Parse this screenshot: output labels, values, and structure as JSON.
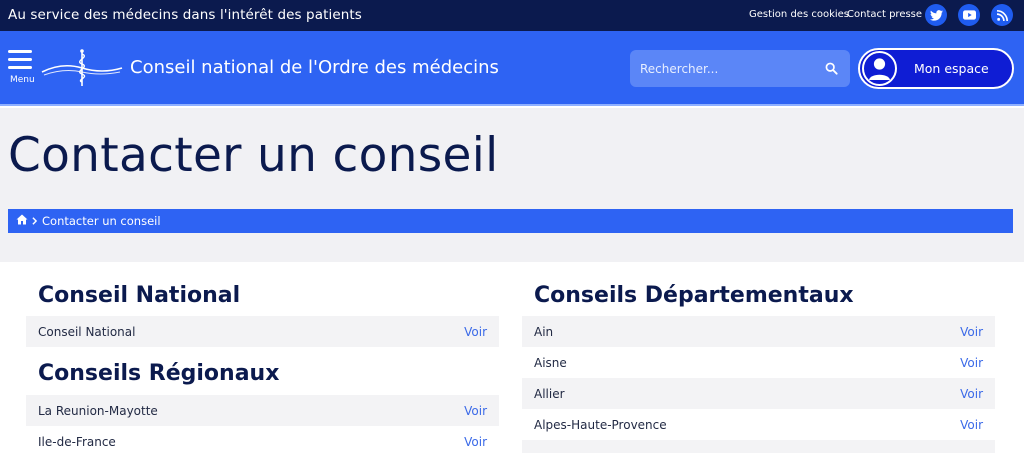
{
  "topbar": {
    "tagline": "Au service des médecins dans l'intérêt des patients",
    "links": [
      "Gestion des cookies",
      "Contact presse"
    ],
    "social_icons": [
      "twitter-icon",
      "youtube-icon",
      "rss-icon"
    ]
  },
  "header": {
    "menu_label": "Menu",
    "site_title": "Conseil national de l'Ordre des médecins",
    "search_placeholder": "Rechercher...",
    "account_label": "Mon espace"
  },
  "hero": {
    "title": "Contacter un conseil"
  },
  "breadcrumb": {
    "current": "Contacter un conseil"
  },
  "sections": {
    "national": {
      "heading": "Conseil National",
      "items": [
        {
          "name": "Conseil National",
          "action": "Voir"
        }
      ]
    },
    "regionaux": {
      "heading": "Conseils Régionaux",
      "items": [
        {
          "name": "La Reunion-Mayotte",
          "action": "Voir"
        },
        {
          "name": "Ile-de-France",
          "action": "Voir"
        }
      ]
    },
    "departementaux": {
      "heading": "Conseils Départementaux",
      "items": [
        {
          "name": "Ain",
          "action": "Voir"
        },
        {
          "name": "Aisne",
          "action": "Voir"
        },
        {
          "name": "Allier",
          "action": "Voir"
        },
        {
          "name": "Alpes-Haute-Provence",
          "action": "Voir"
        }
      ]
    }
  },
  "colors": {
    "navy": "#0b1a4e",
    "brand_blue": "#2e63f3",
    "account_blue": "#0f1dd4",
    "link_blue": "#3b6ae8"
  }
}
